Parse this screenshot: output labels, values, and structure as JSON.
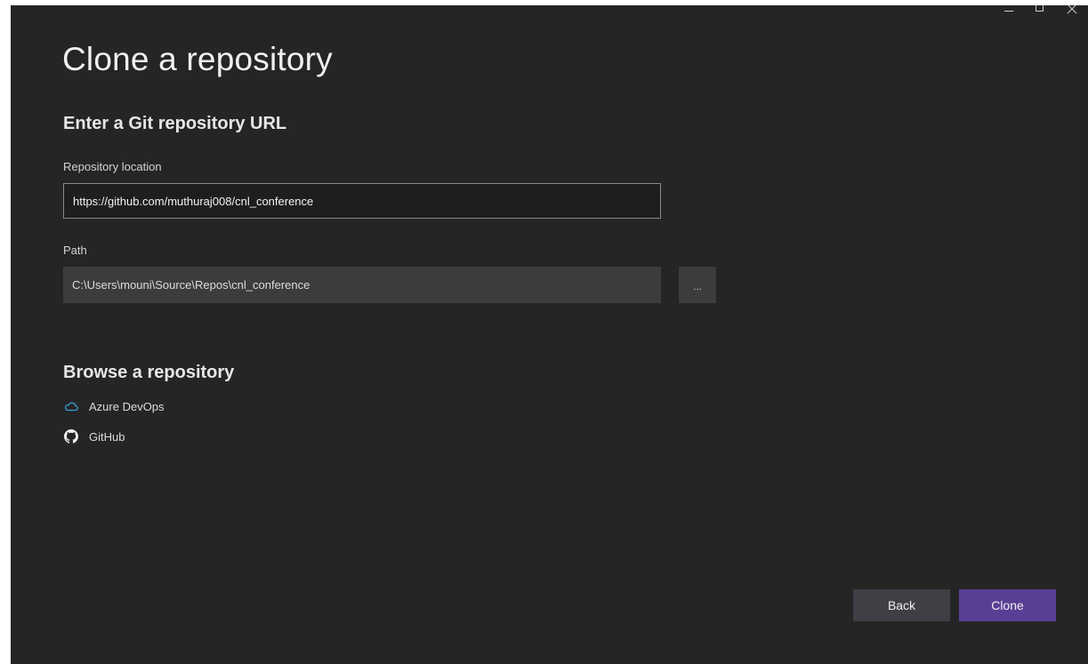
{
  "dialog": {
    "title": "Clone a repository",
    "url_section_title": "Enter a Git repository URL",
    "repository_location_label": "Repository location",
    "repository_location_value": "https://github.com/muthuraj008/cnl_conference",
    "path_label": "Path",
    "path_value": "C:\\Users\\mouni\\Source\\Repos\\cnl_conference",
    "browse_button_label": "...",
    "browse_section_title": "Browse a repository",
    "providers": [
      {
        "label": "Azure DevOps",
        "icon": "cloud-icon"
      },
      {
        "label": "GitHub",
        "icon": "github-icon"
      }
    ],
    "back_label": "Back",
    "clone_label": "Clone"
  },
  "colors": {
    "background": "#252526",
    "accent": "#5a3e96",
    "azure_icon": "#3aa0d8"
  }
}
